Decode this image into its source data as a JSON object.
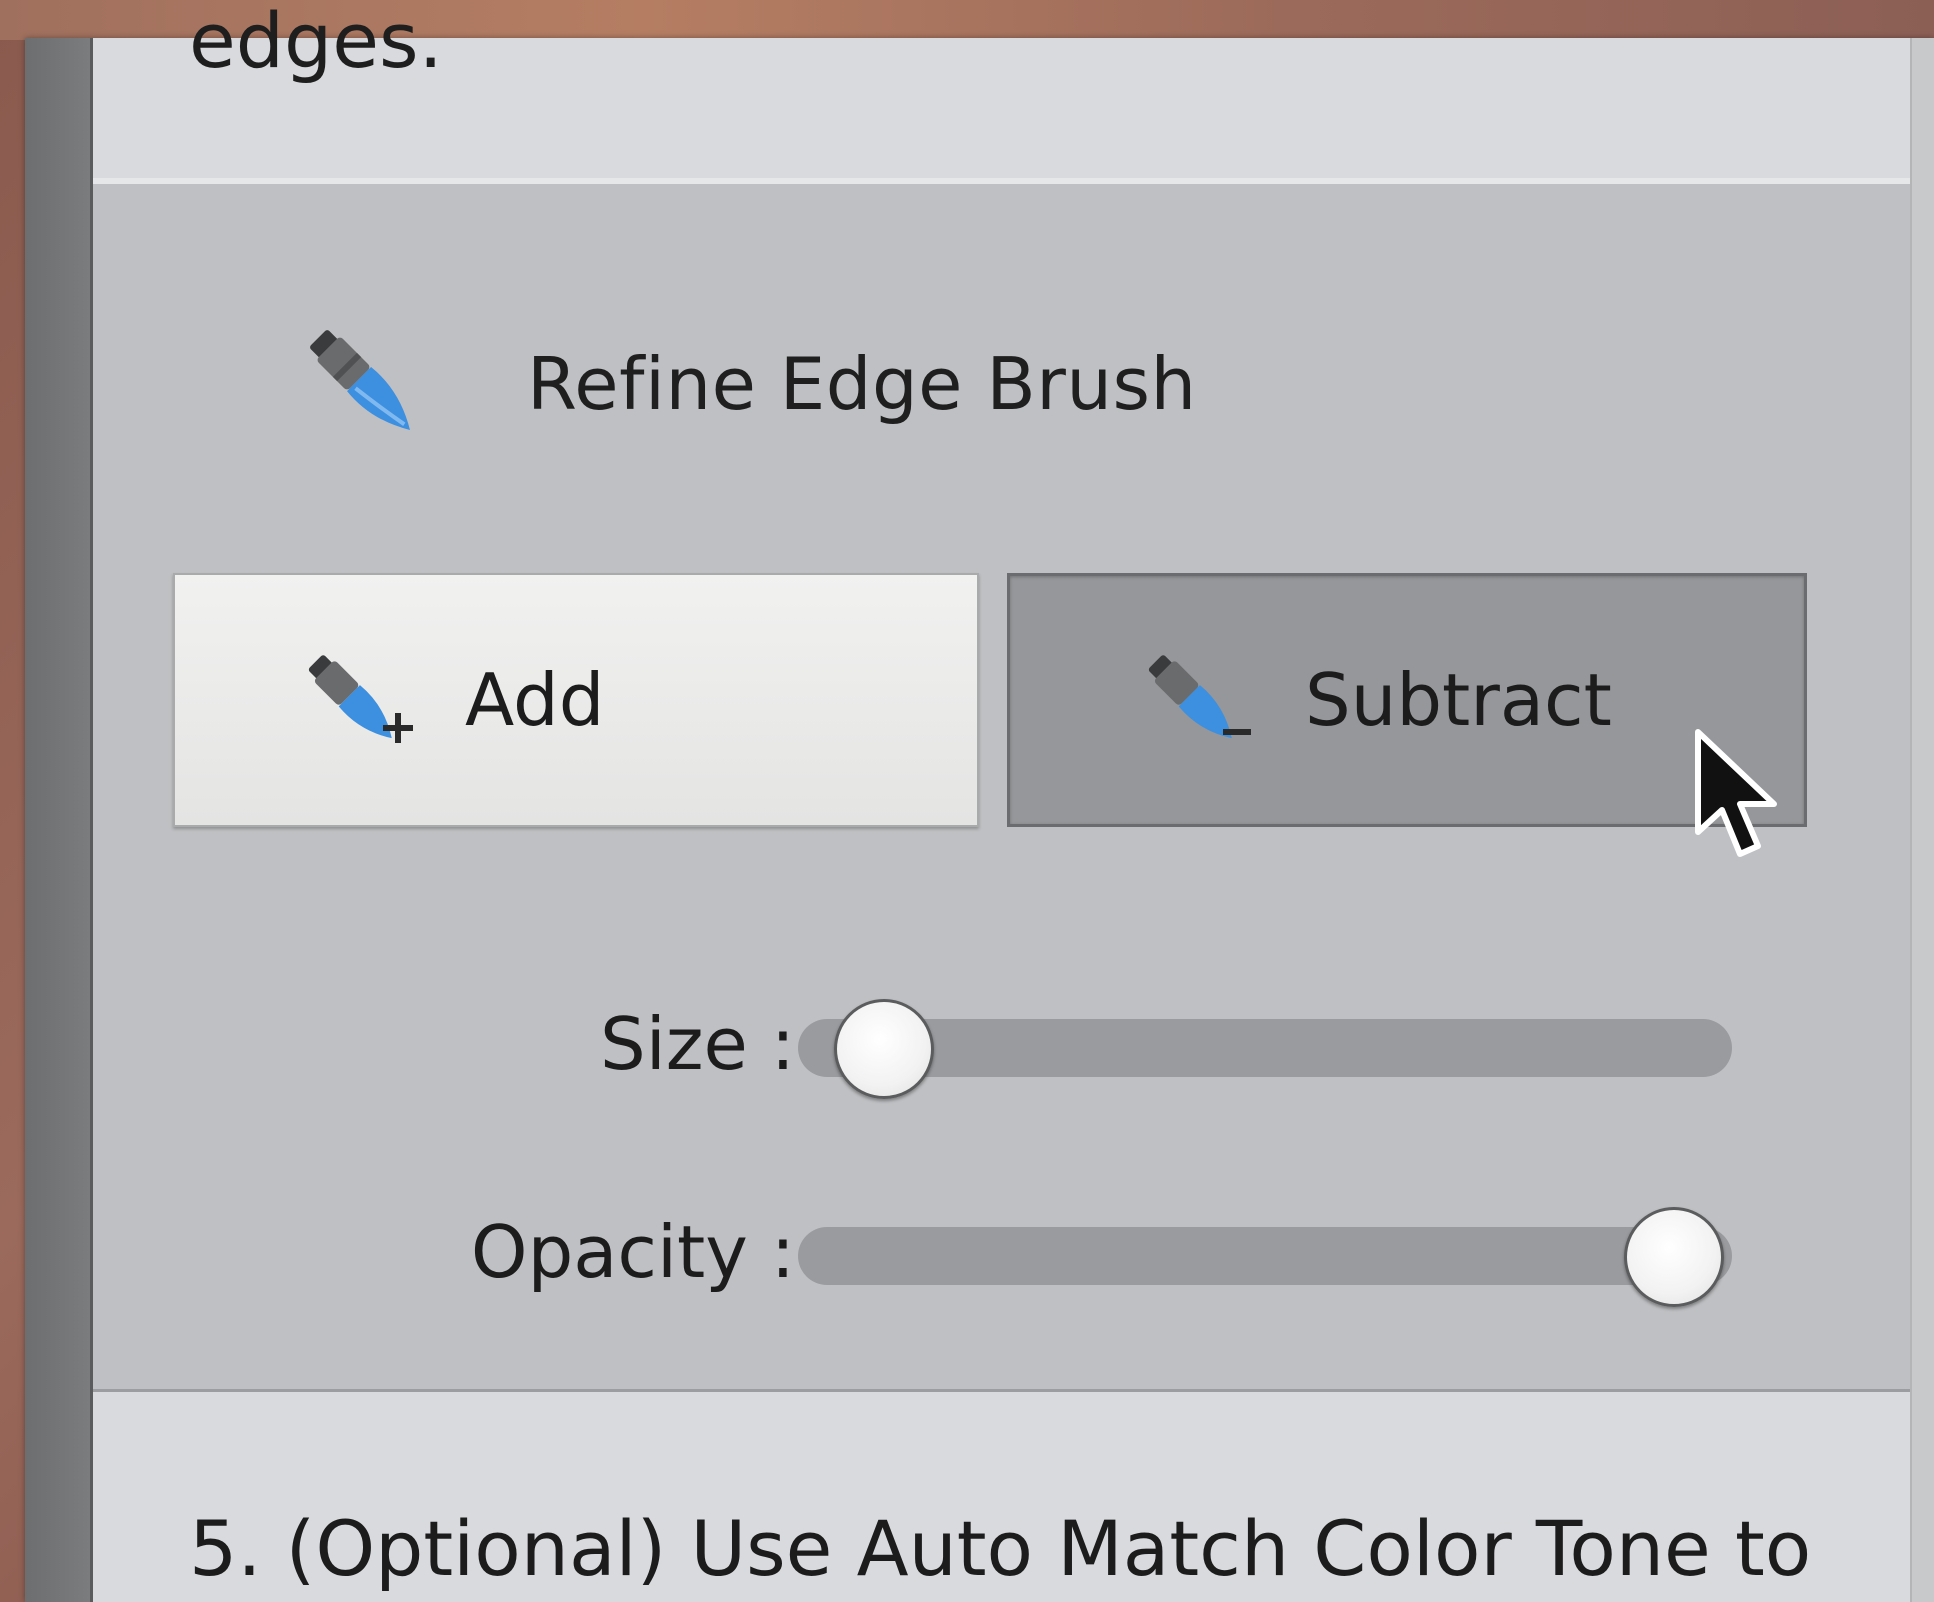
{
  "top_text": "edges.",
  "brush": {
    "title": "Refine Edge Brush",
    "icon": "brush-icon",
    "add_label": "Add",
    "add_icon": "brush-add-icon",
    "subtract_label": "Subtract",
    "subtract_icon": "brush-subtract-icon",
    "selected_mode": "Subtract"
  },
  "sliders": [
    {
      "label": "Size :",
      "value_fraction": 0.1
    },
    {
      "label": "Opacity :",
      "value_fraction": 1.0
    }
  ],
  "step5_text": "5. (Optional) Use Auto Match Color Tone to",
  "colors": {
    "brush_blue": "#3d8fe0",
    "brush_grey": "#6a6b6d"
  }
}
